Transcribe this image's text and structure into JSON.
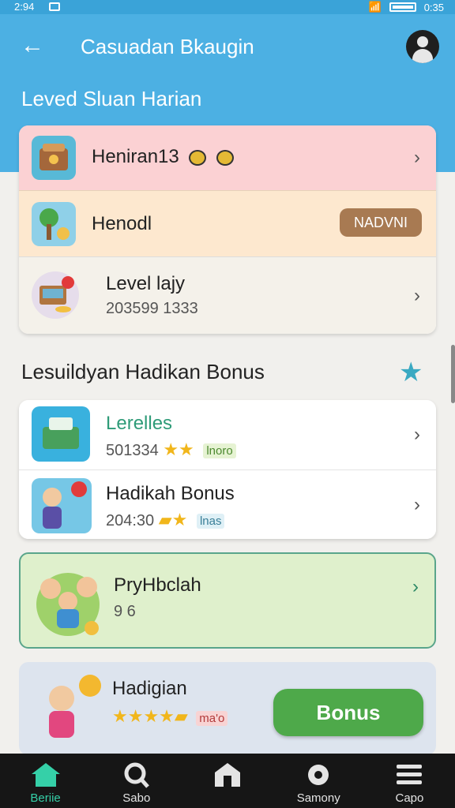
{
  "status": {
    "time": "2:94",
    "time_right": "0:35"
  },
  "header": {
    "title": "Casuadan Bkaugin",
    "section": "Leved Sluan Harian"
  },
  "levels": [
    {
      "label": "Heniran13",
      "chevron": "›"
    },
    {
      "label": "Henodl",
      "button": "NADVNI"
    },
    {
      "label": "Level lajy",
      "sub": "203599 1333",
      "chevron": "›"
    }
  ],
  "bonus_section": {
    "title": "Lesuildyan Hadikan Bonus"
  },
  "bonus_list": [
    {
      "label": "Lerelles",
      "sub": "501334",
      "tag": "lnoro",
      "chevron": "›"
    },
    {
      "label": "Hadikah Bonus",
      "sub": "204:30",
      "tag": "lnas",
      "chevron": "›"
    }
  ],
  "promo_green": {
    "label": "PryHbclah",
    "sub": "9 6",
    "chevron": "›"
  },
  "promo_blue": {
    "label": "Hadigian",
    "tag": "ma'o",
    "button": "Bonus"
  },
  "nav": [
    {
      "label": "Beriie",
      "icon": "home-icon",
      "active": true
    },
    {
      "label": "Sabo",
      "icon": "search-icon"
    },
    {
      "label": "",
      "icon": "house-icon"
    },
    {
      "label": "Samony",
      "icon": "settings-icon"
    },
    {
      "label": "Capo",
      "icon": "menu-icon"
    }
  ],
  "colors": {
    "accent": "#4cb0e3",
    "green": "#4ea94a",
    "nav_active": "#35d0a8"
  }
}
